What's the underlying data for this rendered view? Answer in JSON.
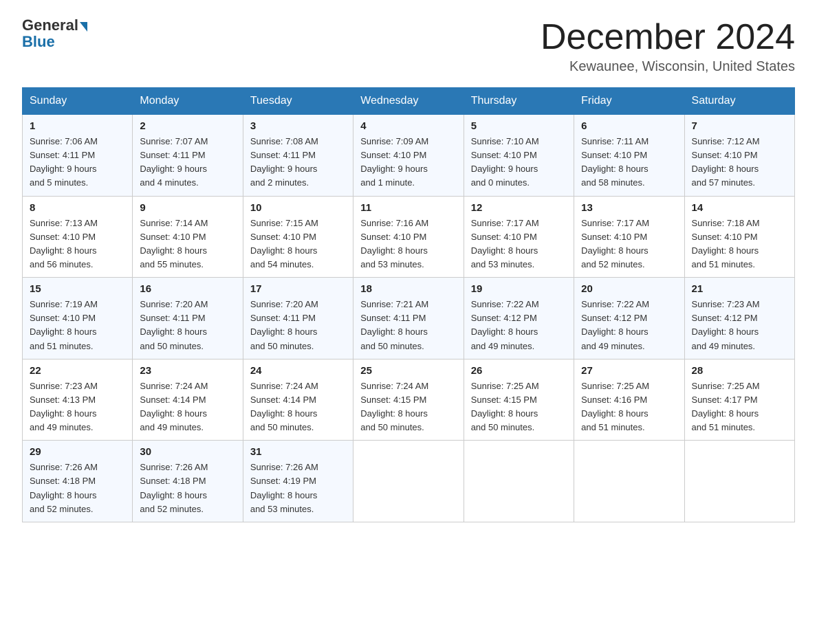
{
  "logo": {
    "general": "General",
    "blue": "Blue"
  },
  "header": {
    "month": "December 2024",
    "location": "Kewaunee, Wisconsin, United States"
  },
  "weekdays": [
    "Sunday",
    "Monday",
    "Tuesday",
    "Wednesday",
    "Thursday",
    "Friday",
    "Saturday"
  ],
  "weeks": [
    [
      {
        "day": "1",
        "sunrise": "7:06 AM",
        "sunset": "4:11 PM",
        "daylight": "9 hours and 5 minutes."
      },
      {
        "day": "2",
        "sunrise": "7:07 AM",
        "sunset": "4:11 PM",
        "daylight": "9 hours and 4 minutes."
      },
      {
        "day": "3",
        "sunrise": "7:08 AM",
        "sunset": "4:11 PM",
        "daylight": "9 hours and 2 minutes."
      },
      {
        "day": "4",
        "sunrise": "7:09 AM",
        "sunset": "4:10 PM",
        "daylight": "9 hours and 1 minute."
      },
      {
        "day": "5",
        "sunrise": "7:10 AM",
        "sunset": "4:10 PM",
        "daylight": "9 hours and 0 minutes."
      },
      {
        "day": "6",
        "sunrise": "7:11 AM",
        "sunset": "4:10 PM",
        "daylight": "8 hours and 58 minutes."
      },
      {
        "day": "7",
        "sunrise": "7:12 AM",
        "sunset": "4:10 PM",
        "daylight": "8 hours and 57 minutes."
      }
    ],
    [
      {
        "day": "8",
        "sunrise": "7:13 AM",
        "sunset": "4:10 PM",
        "daylight": "8 hours and 56 minutes."
      },
      {
        "day": "9",
        "sunrise": "7:14 AM",
        "sunset": "4:10 PM",
        "daylight": "8 hours and 55 minutes."
      },
      {
        "day": "10",
        "sunrise": "7:15 AM",
        "sunset": "4:10 PM",
        "daylight": "8 hours and 54 minutes."
      },
      {
        "day": "11",
        "sunrise": "7:16 AM",
        "sunset": "4:10 PM",
        "daylight": "8 hours and 53 minutes."
      },
      {
        "day": "12",
        "sunrise": "7:17 AM",
        "sunset": "4:10 PM",
        "daylight": "8 hours and 53 minutes."
      },
      {
        "day": "13",
        "sunrise": "7:17 AM",
        "sunset": "4:10 PM",
        "daylight": "8 hours and 52 minutes."
      },
      {
        "day": "14",
        "sunrise": "7:18 AM",
        "sunset": "4:10 PM",
        "daylight": "8 hours and 51 minutes."
      }
    ],
    [
      {
        "day": "15",
        "sunrise": "7:19 AM",
        "sunset": "4:10 PM",
        "daylight": "8 hours and 51 minutes."
      },
      {
        "day": "16",
        "sunrise": "7:20 AM",
        "sunset": "4:11 PM",
        "daylight": "8 hours and 50 minutes."
      },
      {
        "day": "17",
        "sunrise": "7:20 AM",
        "sunset": "4:11 PM",
        "daylight": "8 hours and 50 minutes."
      },
      {
        "day": "18",
        "sunrise": "7:21 AM",
        "sunset": "4:11 PM",
        "daylight": "8 hours and 50 minutes."
      },
      {
        "day": "19",
        "sunrise": "7:22 AM",
        "sunset": "4:12 PM",
        "daylight": "8 hours and 49 minutes."
      },
      {
        "day": "20",
        "sunrise": "7:22 AM",
        "sunset": "4:12 PM",
        "daylight": "8 hours and 49 minutes."
      },
      {
        "day": "21",
        "sunrise": "7:23 AM",
        "sunset": "4:12 PM",
        "daylight": "8 hours and 49 minutes."
      }
    ],
    [
      {
        "day": "22",
        "sunrise": "7:23 AM",
        "sunset": "4:13 PM",
        "daylight": "8 hours and 49 minutes."
      },
      {
        "day": "23",
        "sunrise": "7:24 AM",
        "sunset": "4:14 PM",
        "daylight": "8 hours and 49 minutes."
      },
      {
        "day": "24",
        "sunrise": "7:24 AM",
        "sunset": "4:14 PM",
        "daylight": "8 hours and 50 minutes."
      },
      {
        "day": "25",
        "sunrise": "7:24 AM",
        "sunset": "4:15 PM",
        "daylight": "8 hours and 50 minutes."
      },
      {
        "day": "26",
        "sunrise": "7:25 AM",
        "sunset": "4:15 PM",
        "daylight": "8 hours and 50 minutes."
      },
      {
        "day": "27",
        "sunrise": "7:25 AM",
        "sunset": "4:16 PM",
        "daylight": "8 hours and 51 minutes."
      },
      {
        "day": "28",
        "sunrise": "7:25 AM",
        "sunset": "4:17 PM",
        "daylight": "8 hours and 51 minutes."
      }
    ],
    [
      {
        "day": "29",
        "sunrise": "7:26 AM",
        "sunset": "4:18 PM",
        "daylight": "8 hours and 52 minutes."
      },
      {
        "day": "30",
        "sunrise": "7:26 AM",
        "sunset": "4:18 PM",
        "daylight": "8 hours and 52 minutes."
      },
      {
        "day": "31",
        "sunrise": "7:26 AM",
        "sunset": "4:19 PM",
        "daylight": "8 hours and 53 minutes."
      },
      null,
      null,
      null,
      null
    ]
  ],
  "labels": {
    "sunrise": "Sunrise:",
    "sunset": "Sunset:",
    "daylight": "Daylight:"
  }
}
